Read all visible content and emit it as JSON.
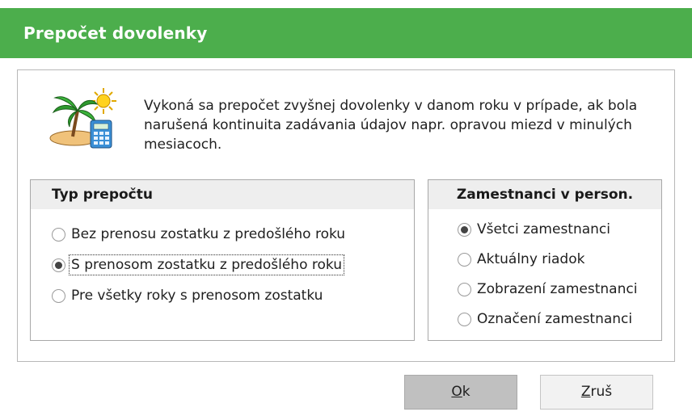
{
  "window": {
    "title": "Prepočet dovolenky"
  },
  "description": "Vykoná sa prepočet zvyšnej dovolenky v danom roku v prípade, ak bola narušená kontinuita zadávania údajov napr. opravou miezd v minulých mesiacoch.",
  "icon": "vacation-calculator-icon",
  "type_group": {
    "title": "Typ prepočtu",
    "options": [
      {
        "label": "Bez prenosu zostatku z predošlého roku",
        "checked": false
      },
      {
        "label": "S prenosom zostatku z predošlého roku",
        "checked": true
      },
      {
        "label": "Pre všetky roky s prenosom zostatku",
        "checked": false
      }
    ]
  },
  "employees_group": {
    "title": "Zamestnanci v person.",
    "options": [
      {
        "label": "Všetci zamestnanci",
        "checked": true
      },
      {
        "label": "Aktuálny riadok",
        "checked": false
      },
      {
        "label": "Zobrazení zamestnanci",
        "checked": false
      },
      {
        "label": "Označení zamestnanci",
        "checked": false
      }
    ]
  },
  "buttons": {
    "ok": {
      "accel": "O",
      "rest": "k"
    },
    "cancel": {
      "accel": "Z",
      "rest": "ruš"
    }
  },
  "colors": {
    "titlebar": "#4cae4c",
    "ok_button": "#c0c0c0"
  }
}
